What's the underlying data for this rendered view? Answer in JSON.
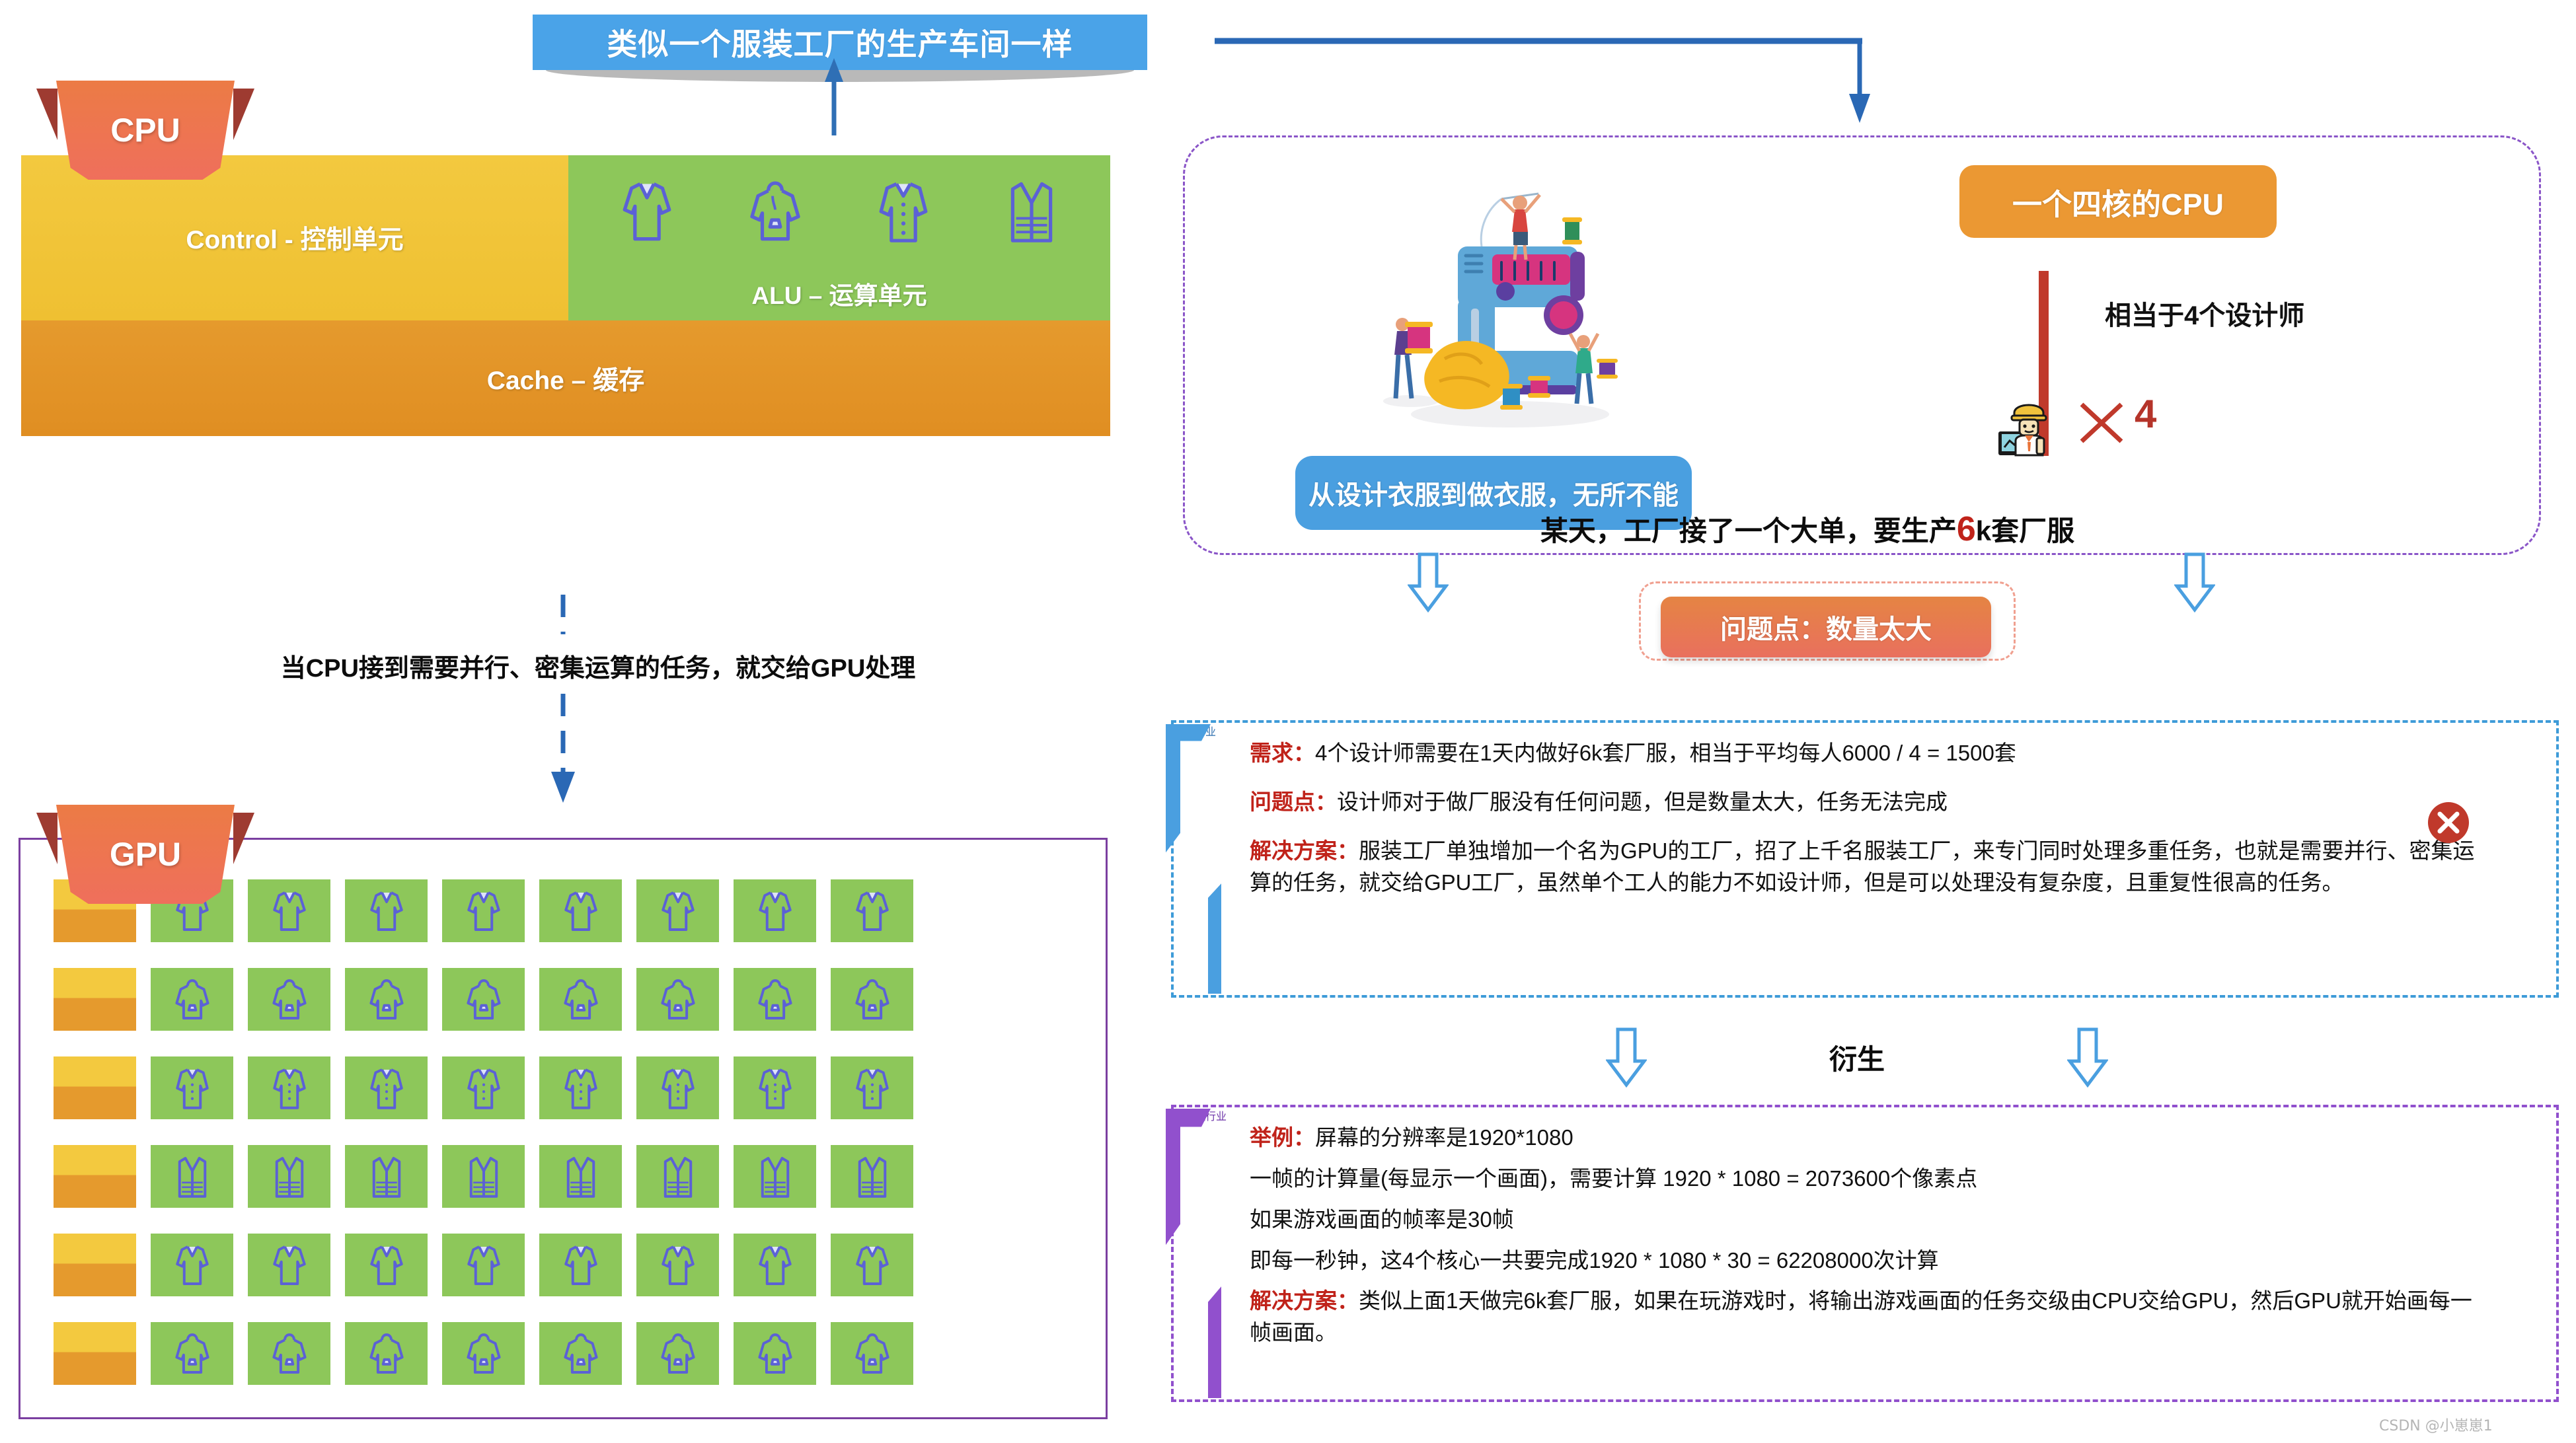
{
  "top_banner": {
    "text": "类似一个服装工厂的生产车间一样"
  },
  "cpu": {
    "ribbon_label": "CPU",
    "control_label": "Control - 控制单元",
    "alu_label": "ALU – 运算单元",
    "cache_label": "Cache – 缓存",
    "alu_icons": [
      "sweater-icon",
      "hoodie-icon",
      "coat-icon",
      "vest-icon"
    ]
  },
  "middle_note": "当CPU接到需要并行、密集运算的任务，就交给GPU处理",
  "gpu": {
    "ribbon_label": "GPU",
    "rows": 6,
    "alu_cells_per_row": 8,
    "row_icons": [
      "sweater-icon",
      "hoodie-icon",
      "coat-icon",
      "vest-icon",
      "sweater-icon",
      "hoodie-icon"
    ]
  },
  "right_panel": {
    "illustration": "sewing-machine-illustration",
    "tagline": "从设计衣服到做衣服，无所不能",
    "quadcore_badge": "一个四核的CPU",
    "equivalent_text": "相当于4个设计师",
    "designer_icon": "engineer-designer-icon",
    "multiply_symbol": "×",
    "multiply_count": "4",
    "big_order_prefix": "某天，工厂接了一个大单，要生产",
    "big_order_highlight": "6",
    "big_order_suffix": "k套厂服",
    "problem_badge": "问题点：数量太大"
  },
  "clothing_industry": {
    "vertical_label": "服装行业",
    "lines": [
      {
        "label": "需求：",
        "text": "4个设计师需要在1天内做好6k套厂服，相当于平均每人6000 / 4 = 1500套"
      },
      {
        "label": "问题点：",
        "text": "设计师对于做厂服没有任何问题，但是数量太大，任务无法完成"
      },
      {
        "label": "解决方案：",
        "text": "服装工厂单独增加一个名为GPU的工厂，招了上千名服装工厂，来专门同时处理多重任务，也就是需要并行、密集运算的任务，就交给GPU工厂，虽然单个工人的能力不如设计师，但是可以处理没有复杂度，且重复性很高的任务。"
      }
    ],
    "status_icon": "x-circle-icon"
  },
  "derive": {
    "text": "衍生"
  },
  "computer_industry": {
    "vertical_label": "计算机行业",
    "lines": [
      {
        "label": "举例：",
        "text": "屏幕的分辨率是1920*1080"
      },
      {
        "label": "",
        "text": "一帧的计算量(每显示一个画面)，需要计算 1920 * 1080 = 2073600个像素点"
      },
      {
        "label": "",
        "text": "如果游戏画面的帧率是30帧"
      },
      {
        "label": "",
        "text": "即每一秒钟，这4个核心一共要完成1920 * 1080 * 30  = 62208000次计算"
      },
      {
        "label": "解决方案：",
        "text": "类似上面1天做完6k套厂服，如果在玩游戏时，将输出游戏画面的任务交级由CPU交给GPU，然后GPU就开始画每一帧画面。"
      }
    ]
  },
  "watermark": "CSDN @小崽崽1",
  "colors": {
    "banner_blue": "#4aa3e8",
    "control_yellow": "#f3c93f",
    "alu_green": "#8dc75a",
    "cache_orange": "#e59a2d",
    "ribbon_orange": "#ec7b45",
    "gpu_border_purple": "#7b3fa0",
    "panel_dash_purple": "#8a55c8",
    "clothing_border": "#3e9bd8",
    "computer_border": "#9150cd",
    "accent_red": "#c0231a",
    "badge_orange": "#eb9833"
  }
}
